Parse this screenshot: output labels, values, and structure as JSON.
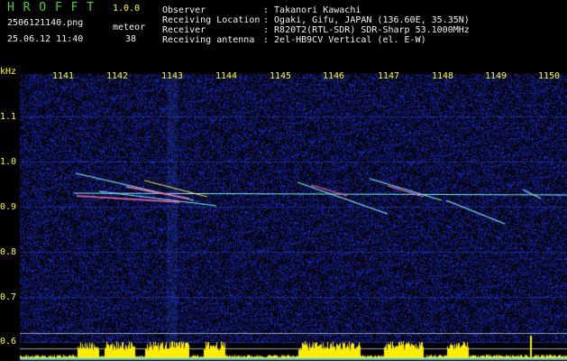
{
  "app": {
    "title": "H R O F F T",
    "version": "1.0.0",
    "filename": "2506121140.png",
    "datetime": "25.06.12 11:40",
    "meteor_label": "meteor",
    "meteor_count": "38"
  },
  "info": {
    "rows": [
      {
        "key": "Observer",
        "value": ": Takanori Kawachi"
      },
      {
        "key": "Receiving Location",
        "value": ": Ogaki, Gifu, JAPAN (136.60E, 35.35N)"
      },
      {
        "key": "Receiver",
        "value": ": R820T2(RTL-SDR) SDR-Sharp 53.1000MHz"
      },
      {
        "key": "Receiving antenna",
        "value": ": 2el-HB9CV Vertical (el. E-W)"
      }
    ]
  },
  "axes": {
    "y_unit": "kHz",
    "y_ticks": [
      "1.1",
      "1.0",
      "0.9",
      "0.8",
      "0.7",
      "0.6"
    ],
    "x_ticks": [
      "1141",
      "1142",
      "1143",
      "1144",
      "1145",
      "1146",
      "1147",
      "1148",
      "1149",
      "1150"
    ]
  },
  "colors": {
    "background": "#000000",
    "noise": "#1a2fb0",
    "trace_cyan": "#7ff0ff",
    "trace_pink": "#ff6aa8",
    "trace_yellow": "#ffee44",
    "baseline_bar": "#ffee00"
  }
}
